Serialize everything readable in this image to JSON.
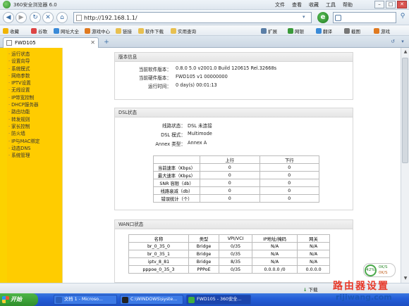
{
  "window": {
    "title": "360安全浏览器 6.0",
    "menus": [
      "文件",
      "查看",
      "收藏",
      "工具",
      "帮助"
    ],
    "buttons": {
      "minimize": "–",
      "restore": "□",
      "close": "✕"
    }
  },
  "address": {
    "url": "http://192.168.1.1/",
    "search_placeholder": ""
  },
  "favorites": {
    "items": [
      {
        "label": "收藏",
        "icon": "star-icon",
        "color": "#f0b400"
      },
      {
        "label": "谷歌",
        "icon": "google-icon",
        "color": "#d44"
      },
      {
        "label": "网址大全",
        "icon": "globe-icon",
        "color": "#3a8ad8"
      },
      {
        "label": "游戏中心",
        "icon": "game-icon",
        "color": "#e07a20"
      },
      {
        "label": "链接",
        "icon": "folder-icon",
        "color": "#e8c050"
      },
      {
        "label": "软件下载",
        "icon": "folder-icon",
        "color": "#e8c050"
      },
      {
        "label": "实用查询",
        "icon": "folder-icon",
        "color": "#e8c050"
      }
    ],
    "right_items": [
      {
        "label": "扩展",
        "icon": "grid-icon",
        "color": "#5a7ea6"
      },
      {
        "label": "网银",
        "icon": "shield-icon",
        "color": "#3a9a3a"
      },
      {
        "label": "翻译",
        "icon": "translate-icon",
        "color": "#3a8ad8"
      },
      {
        "label": "截图",
        "icon": "scissors-icon",
        "color": "#777"
      },
      {
        "label": "游戏",
        "icon": "gamepad-icon",
        "color": "#e07a20"
      }
    ]
  },
  "tab": {
    "label": "FWD105",
    "close": "✕",
    "new": "+"
  },
  "sidebar": {
    "items": [
      "运行状态",
      "设置向导",
      "系统模式",
      "网络参数",
      "IPTV设置",
      "无线设置",
      "IP带宽控制",
      "DHCP服务器",
      "路由功能",
      "转发规则",
      "家长控制",
      "防火墙",
      "IP与MAC绑定",
      "动态DNS",
      "系统管理"
    ]
  },
  "version": {
    "title": "版本信息",
    "rows": [
      {
        "k": "当前软件版本：",
        "v": "0.8.0 5.0 v2001.0 Build 120615 Rel.32668s"
      },
      {
        "k": "当前硬件版本：",
        "v": "FWD105 v1 00000000"
      },
      {
        "k": "运行时间：",
        "v": "0 day(s) 00:01:13"
      }
    ]
  },
  "dsl": {
    "title": "DSL状态",
    "rows": [
      {
        "k": "线路状态：",
        "v": "DSL 未连接"
      },
      {
        "k": "DSL 模式：",
        "v": "Multimode"
      },
      {
        "k": "Annex 类型：",
        "v": "Annex A"
      }
    ],
    "table": {
      "headers": [
        "",
        "上行",
        "下行"
      ],
      "rows": [
        [
          "当前速率（Kbps）",
          "0",
          "0"
        ],
        [
          "最大速率（Kbps）",
          "0",
          "0"
        ],
        [
          "SNR 容限（db）",
          "0",
          "0"
        ],
        [
          "线路衰减（db）",
          "0",
          "0"
        ],
        [
          "错误统计（个）",
          "0",
          "0"
        ]
      ]
    }
  },
  "wan": {
    "title": "WAN口状态",
    "table": {
      "headers": [
        "名称",
        "类型",
        "VPI/VCI",
        "IP地址/掩码",
        "网关"
      ],
      "rows": [
        [
          "br_0_35_0",
          "Bridge",
          "0/35",
          "N/A",
          "N/A"
        ],
        [
          "br_0_35_1",
          "Bridge",
          "0/35",
          "N/A",
          "N/A"
        ],
        [
          "iptv_8_81",
          "Bridge",
          "8/35",
          "N/A",
          "N/A"
        ],
        [
          "pppoe_0_35_3",
          "PPPoE",
          "0/35",
          "0.0.0.0 /0",
          "0.0.0.0"
        ]
      ]
    }
  },
  "status": {
    "download": "下载",
    "net_percent": "42%",
    "up_speed": "0K/S",
    "down_speed": "0K/S"
  },
  "taskbar": {
    "start": "开始",
    "items": [
      {
        "label": "文档 1 - Microso...",
        "icon_color": "#2a5fc0"
      },
      {
        "label": "C:\\WINDOWS\\syste...",
        "icon_color": "#222"
      },
      {
        "label": "FWD105 - 360安全...",
        "icon_color": "#3fae3f"
      }
    ]
  },
  "watermark": {
    "line1": "路由器设置",
    "line2": "rijiwang.com"
  }
}
